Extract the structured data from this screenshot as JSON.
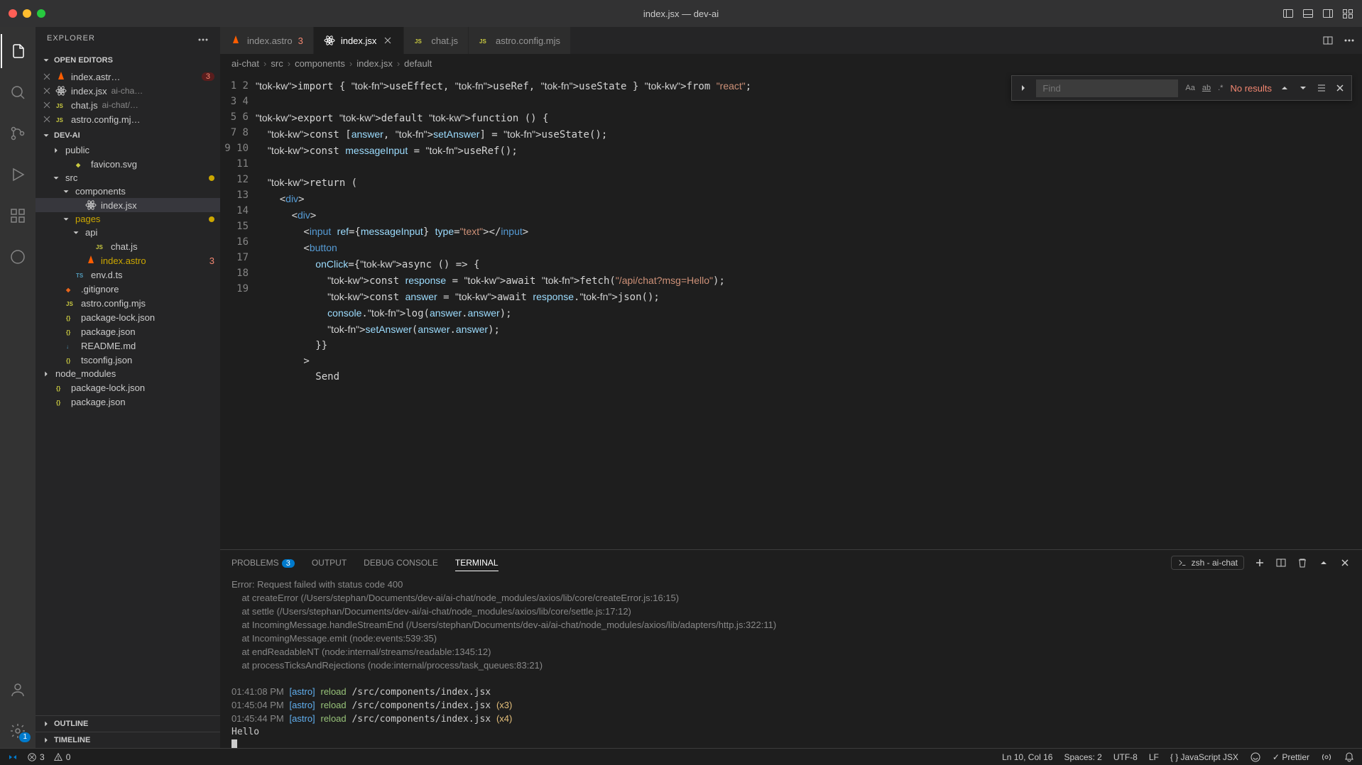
{
  "window": {
    "title": "index.jsx — dev-ai"
  },
  "sidebar": {
    "title": "EXPLORER",
    "openEditors": {
      "label": "OPEN EDITORS",
      "items": [
        {
          "name": "index.astr…",
          "dim": "",
          "errors": "3"
        },
        {
          "name": "index.jsx",
          "dim": "ai-cha…",
          "errors": ""
        },
        {
          "name": "chat.js",
          "dim": "ai-chat/…",
          "errors": ""
        },
        {
          "name": "astro.config.mj…",
          "dim": "",
          "errors": ""
        }
      ]
    },
    "project": "DEV-AI",
    "tree": [
      {
        "depth": 1,
        "chev": "right",
        "label": "public",
        "icon": "folder"
      },
      {
        "depth": 2,
        "chev": "",
        "label": "favicon.svg",
        "icon": "svg"
      },
      {
        "depth": 1,
        "chev": "down",
        "label": "src",
        "icon": "folder",
        "modified": true
      },
      {
        "depth": 2,
        "chev": "down",
        "label": "components",
        "icon": "folder"
      },
      {
        "depth": 3,
        "chev": "",
        "label": "index.jsx",
        "icon": "react",
        "selected": true
      },
      {
        "depth": 2,
        "chev": "down",
        "label": "pages",
        "icon": "folder",
        "orange": true,
        "modified": true
      },
      {
        "depth": 3,
        "chev": "down",
        "label": "api",
        "icon": "folder"
      },
      {
        "depth": 4,
        "chev": "",
        "label": "chat.js",
        "icon": "js"
      },
      {
        "depth": 3,
        "chev": "",
        "label": "index.astro",
        "icon": "astro",
        "errn": "3",
        "orange": true
      },
      {
        "depth": 2,
        "chev": "",
        "label": "env.d.ts",
        "icon": "ts"
      },
      {
        "depth": 1,
        "chev": "",
        "label": ".gitignore",
        "icon": "git"
      },
      {
        "depth": 1,
        "chev": "",
        "label": "astro.config.mjs",
        "icon": "js"
      },
      {
        "depth": 1,
        "chev": "",
        "label": "package-lock.json",
        "icon": "json"
      },
      {
        "depth": 1,
        "chev": "",
        "label": "package.json",
        "icon": "json"
      },
      {
        "depth": 1,
        "chev": "",
        "label": "README.md",
        "icon": "md"
      },
      {
        "depth": 1,
        "chev": "",
        "label": "tsconfig.json",
        "icon": "json"
      },
      {
        "depth": 0,
        "chev": "right",
        "label": "node_modules",
        "icon": "folder"
      },
      {
        "depth": 0,
        "chev": "",
        "label": "package-lock.json",
        "icon": "json"
      },
      {
        "depth": 0,
        "chev": "",
        "label": "package.json",
        "icon": "json"
      }
    ],
    "outline": "OUTLINE",
    "timeline": "TIMELINE"
  },
  "tabs": [
    {
      "label": "index.astro",
      "icon": "astro",
      "err": "3",
      "active": false
    },
    {
      "label": "index.jsx",
      "icon": "react",
      "err": "",
      "active": true,
      "closable": true
    },
    {
      "label": "chat.js",
      "icon": "js",
      "err": "",
      "active": false
    },
    {
      "label": "astro.config.mjs",
      "icon": "js",
      "err": "",
      "active": false
    }
  ],
  "breadcrumbs": [
    "ai-chat",
    "src",
    "components",
    "index.jsx",
    "default"
  ],
  "find": {
    "placeholder": "Find",
    "noresults": "No results"
  },
  "code_lines": [
    "import { useEffect, useRef, useState } from \"react\";",
    "",
    "export default function () {",
    "  const [answer, setAnswer] = useState();",
    "  const messageInput = useRef();",
    "",
    "  return (",
    "    <div>",
    "      <div>",
    "        <input ref={messageInput} type=\"text\"></input>",
    "        <button",
    "          onClick={async () => {",
    "            const response = await fetch(\"/api/chat?msg=Hello\");",
    "            const answer = await response.json();",
    "            console.log(answer.answer);",
    "            setAnswer(answer.answer);",
    "          }}",
    "        >",
    "          Send"
  ],
  "panel": {
    "tabs": {
      "problems": "PROBLEMS",
      "problemsCount": "3",
      "output": "OUTPUT",
      "debug": "DEBUG CONSOLE",
      "terminal": "TERMINAL"
    },
    "shell": "zsh - ai-chat",
    "terminal_lines": [
      "Error: Request failed with status code 400",
      "    at createError (/Users/stephan/Documents/dev-ai/ai-chat/node_modules/axios/lib/core/createError.js:16:15)",
      "    at settle (/Users/stephan/Documents/dev-ai/ai-chat/node_modules/axios/lib/core/settle.js:17:12)",
      "    at IncomingMessage.handleStreamEnd (/Users/stephan/Documents/dev-ai/ai-chat/node_modules/axios/lib/adapters/http.js:322:11)",
      "    at IncomingMessage.emit (node:events:539:35)",
      "    at endReadableNT (node:internal/streams/readable:1345:12)",
      "    at processTicksAndRejections (node:internal/process/task_queues:83:21)",
      "",
      "01:41:08 PM [astro] reload /src/components/index.jsx",
      "01:45:04 PM [astro] reload /src/components/index.jsx (x3)",
      "01:45:44 PM [astro] reload /src/components/index.jsx (x4)",
      "Hello"
    ]
  },
  "status": {
    "errors": "3",
    "warnings": "0",
    "cursor": "Ln 10, Col 16",
    "spaces": "Spaces: 2",
    "encoding": "UTF-8",
    "eol": "LF",
    "lang": "JavaScript JSX",
    "prettier": "Prettier"
  }
}
